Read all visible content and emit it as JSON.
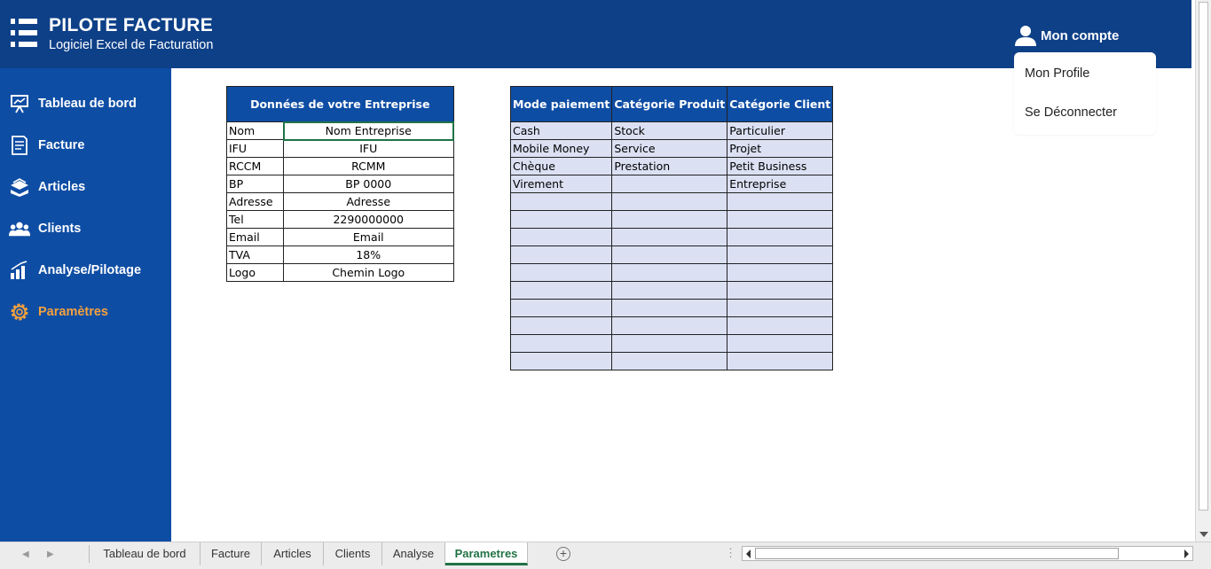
{
  "header": {
    "title": "PILOTE FACTURE",
    "subtitle": "Logiciel Excel de Facturation",
    "account_label": "Mon compte"
  },
  "account_menu": {
    "items": [
      "Mon Profile",
      "Se Déconnecter"
    ]
  },
  "sidebar": {
    "items": [
      {
        "label": "Tableau de bord",
        "icon": "presentation-board-icon"
      },
      {
        "label": "Facture",
        "icon": "invoice-icon"
      },
      {
        "label": "Articles",
        "icon": "boxes-icon"
      },
      {
        "label": "Clients",
        "icon": "users-icon"
      },
      {
        "label": "Analyse/Pilotage",
        "icon": "bar-chart-icon"
      },
      {
        "label": "Paramètres",
        "icon": "gear-icon",
        "active": true
      }
    ],
    "active_color": "#f4a13d"
  },
  "company": {
    "header": "Données de votre Entreprise",
    "rows": [
      {
        "key": "Nom",
        "value": "Nom Entreprise"
      },
      {
        "key": "IFU",
        "value": "IFU"
      },
      {
        "key": "RCCM",
        "value": "RCMM"
      },
      {
        "key": "BP",
        "value": "BP 0000"
      },
      {
        "key": "Adresse",
        "value": "Adresse"
      },
      {
        "key": "Tel",
        "value": "2290000000"
      },
      {
        "key": "Email",
        "value": "Email"
      },
      {
        "key": "TVA",
        "value": "18%"
      },
      {
        "key": "Logo",
        "value": "Chemin Logo"
      }
    ]
  },
  "lists": {
    "headers": [
      "Mode paiement",
      "Catégorie Produit",
      "Catégorie Client"
    ],
    "rows": [
      [
        "Cash",
        "Stock",
        "Particulier"
      ],
      [
        "Mobile Money",
        "Service",
        "Projet"
      ],
      [
        "Chèque",
        "Prestation",
        "Petit Business"
      ],
      [
        "Virement",
        "",
        "Entreprise"
      ],
      [
        "",
        "",
        ""
      ],
      [
        "",
        "",
        ""
      ],
      [
        "",
        "",
        ""
      ],
      [
        "",
        "",
        ""
      ],
      [
        "",
        "",
        ""
      ],
      [
        "",
        "",
        ""
      ],
      [
        "",
        "",
        ""
      ],
      [
        "",
        "",
        ""
      ],
      [
        "",
        "",
        ""
      ],
      [
        "",
        "",
        ""
      ]
    ]
  },
  "sheet_tabs": {
    "tabs": [
      "Tableau de bord",
      "Facture",
      "Articles",
      "Clients",
      "Analyse",
      "Parametres"
    ],
    "active": "Parametres"
  },
  "colors": {
    "header_bg": "#0e4088",
    "sidebar_bg": "#0e4da4",
    "list_cell_bg": "#dbe1f3",
    "excel_green": "#217346"
  }
}
